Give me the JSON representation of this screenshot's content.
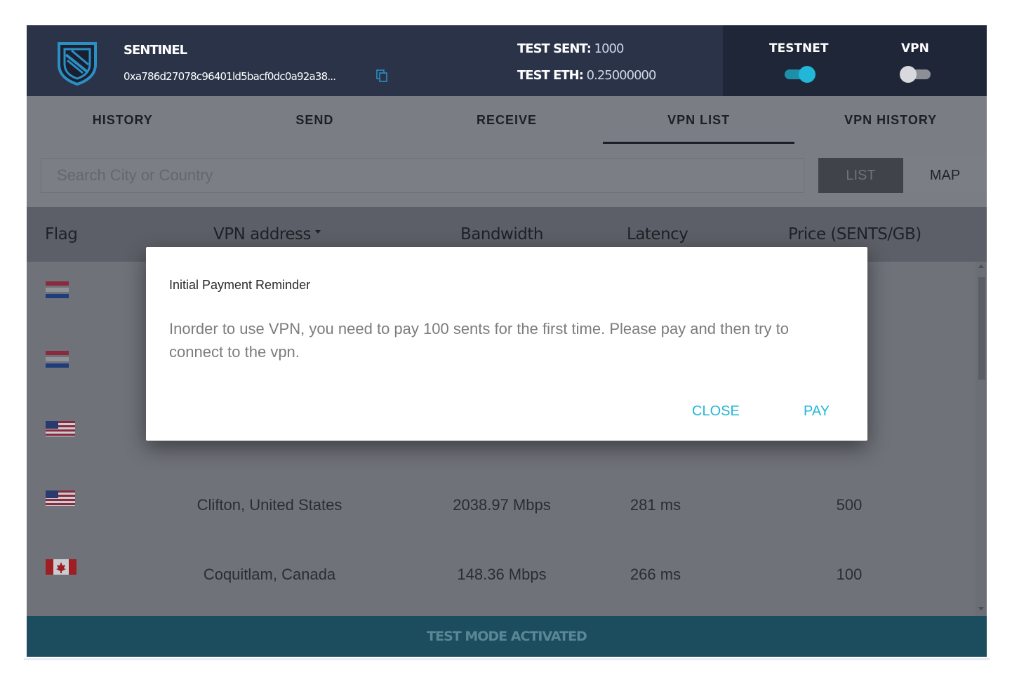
{
  "header": {
    "brand": "SENTINEL",
    "wallet_address": "0xa786d27078c96401ld5bacf0dc0a92a38...",
    "test_sent_label": "TEST SENT:",
    "test_sent_value": "1000",
    "test_eth_label": "TEST ETH:",
    "test_eth_value": "0.25000000",
    "testnet_label": "TESTNET",
    "testnet_on": true,
    "vpn_label": "VPN",
    "vpn_on": false
  },
  "tabs": [
    {
      "label": "HISTORY"
    },
    {
      "label": "SEND"
    },
    {
      "label": "RECEIVE"
    },
    {
      "label": "VPN LIST",
      "active": true
    },
    {
      "label": "VPN HISTORY"
    }
  ],
  "search": {
    "placeholder": "Search City or Country",
    "value": "",
    "list_label": "LIST",
    "map_label": "MAP"
  },
  "table": {
    "columns": [
      "Flag",
      "VPN address",
      "Bandwidth",
      "Latency",
      "Price (SENTS/GB)"
    ],
    "rows": [
      {
        "flag": "netherlands",
        "address": "",
        "bandwidth": "",
        "latency": "",
        "price": ""
      },
      {
        "flag": "netherlands",
        "address": "",
        "bandwidth": "",
        "latency": "",
        "price": ""
      },
      {
        "flag": "united-states",
        "address": "",
        "bandwidth": "",
        "latency": "",
        "price": ""
      },
      {
        "flag": "united-states",
        "address": "Clifton, United States",
        "bandwidth": "2038.97 Mbps",
        "latency": "281 ms",
        "price": "500"
      },
      {
        "flag": "canada",
        "address": "Coquitlam, Canada",
        "bandwidth": "148.36 Mbps",
        "latency": "266 ms",
        "price": "100"
      }
    ]
  },
  "footer": {
    "status": "TEST MODE ACTIVATED"
  },
  "dialog": {
    "title": "Initial Payment Reminder",
    "body": "Inorder to use VPN, you need to pay 100 sents for the first time. Please pay and then try to connect to the vpn.",
    "close_label": "CLOSE",
    "pay_label": "PAY"
  },
  "colors": {
    "header_bg": "#2a3348",
    "accent": "#22b6d8",
    "footer_bg": "#1b4d5f"
  }
}
